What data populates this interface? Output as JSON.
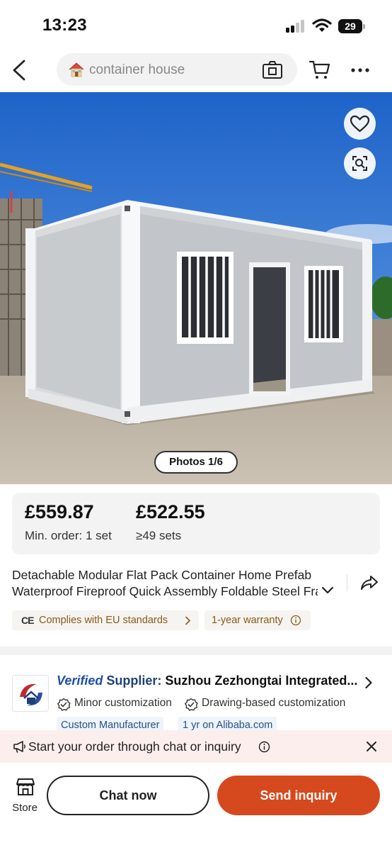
{
  "status_bar": {
    "time": "13:23",
    "battery": "29"
  },
  "nav": {
    "search_text": "container house"
  },
  "hero": {
    "photos_badge": "Photos 1/6"
  },
  "pricing": {
    "tiers": [
      {
        "price": "£559.87",
        "quantity": "Min. order: 1 set"
      },
      {
        "price": "£522.55",
        "quantity": "≥49 sets"
      }
    ]
  },
  "product": {
    "title_line1": "Detachable Modular Flat Pack Container Home Prefab",
    "title_line2": "Waterproof Fireproof Quick Assembly Foldable Steel Fra"
  },
  "badges": {
    "eu_mark": "CE",
    "eu": "Complies with EU standards",
    "warranty": "1-year warranty"
  },
  "supplier": {
    "verified": "Verified",
    "supplier_word": "Supplier:",
    "name": "Suzhou Zezhongtai Integrated...",
    "capabilities": [
      "Minor customization",
      "Drawing-based customization"
    ],
    "tags": [
      "Custom Manufacturer",
      "1 yr on Alibaba.com"
    ]
  },
  "banner": {
    "text": "Start your order through chat or inquiry"
  },
  "bottom_bar": {
    "store_label": "Store",
    "chat_label": "Chat now",
    "inquiry_label": "Send inquiry"
  },
  "colors": {
    "accent": "#d6491e",
    "badge_text": "#8a5a18",
    "verified_blue": "#1f4fa8",
    "banner_bg": "#fdeeee"
  },
  "icons": [
    "back-arrow-icon",
    "house-emoji-icon",
    "camera-search-icon",
    "cart-icon",
    "more-icon",
    "heart-icon",
    "image-search-icon",
    "chevron-down-icon",
    "share-icon",
    "chevron-right-icon",
    "info-icon",
    "check-badge-icon",
    "megaphone-icon",
    "close-icon",
    "store-icon"
  ]
}
